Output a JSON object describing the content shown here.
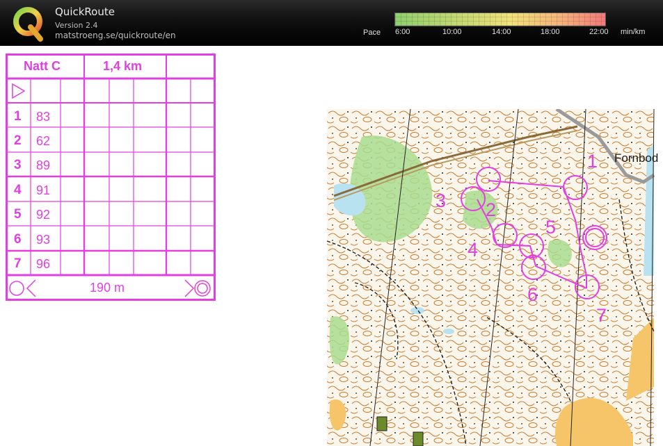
{
  "app": {
    "title": "QuickRoute",
    "version": "Version 2.4",
    "url": "matstroeng.se/quickroute/en"
  },
  "pace_scale": {
    "label": "Pace",
    "ticks": [
      "6:00",
      "10:00",
      "14:00",
      "18:00",
      "22:00"
    ],
    "unit": "min/km"
  },
  "description_sheet": {
    "event_name": "Natt C",
    "course_length": "1,4 km",
    "controls": [
      {
        "number": "1",
        "code": "83"
      },
      {
        "number": "2",
        "code": "62"
      },
      {
        "number": "3",
        "code": "89"
      },
      {
        "number": "4",
        "code": "91"
      },
      {
        "number": "5",
        "code": "92"
      },
      {
        "number": "6",
        "code": "93"
      },
      {
        "number": "7",
        "code": "96"
      }
    ],
    "finish_distance": "190 m"
  },
  "map": {
    "control_labels": [
      "1",
      "2",
      "3",
      "4",
      "5",
      "6",
      "7"
    ],
    "place_name": "Fornbod",
    "colors": {
      "overprint": "#e23fe2",
      "contour": "#c87a2e",
      "open_land": "#f6c56a",
      "vegetation": "#a9dc8f",
      "water": "#b8e2f0"
    }
  }
}
